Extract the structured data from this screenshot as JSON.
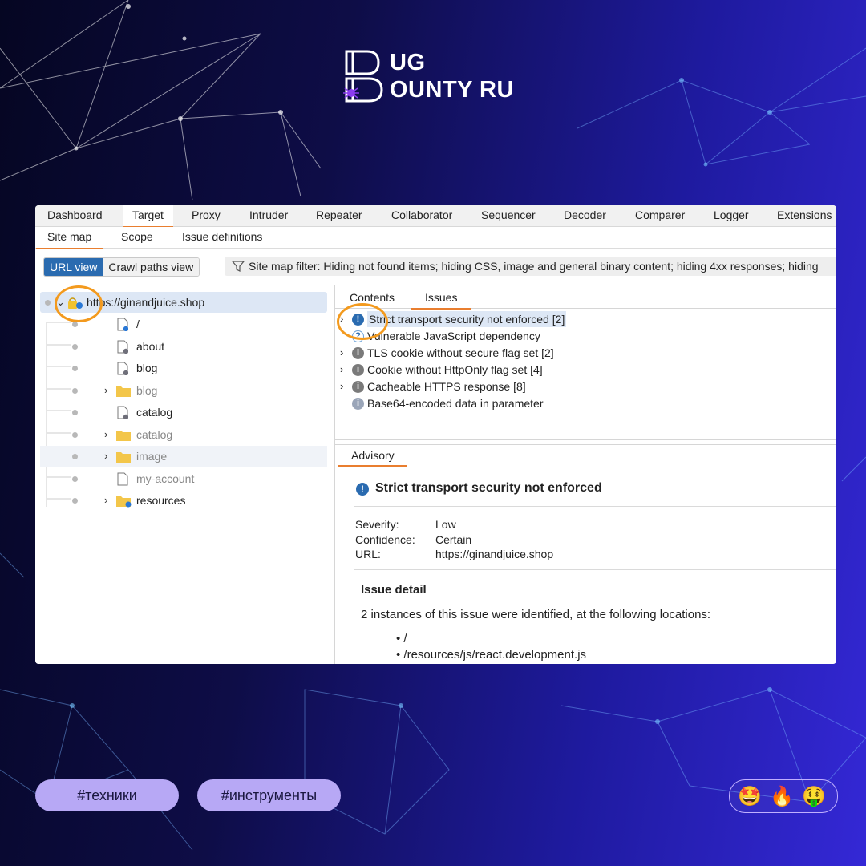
{
  "brand": {
    "line1": "UG",
    "line2": "OUNTY RU",
    "mark_letters": "BB"
  },
  "main_tabs": [
    "Dashboard",
    "Target",
    "Proxy",
    "Intruder",
    "Repeater",
    "Collaborator",
    "Sequencer",
    "Decoder",
    "Comparer",
    "Logger",
    "Extensions"
  ],
  "active_main_tab": "Target",
  "sub_tabs": [
    "Site map",
    "Scope",
    "Issue definitions"
  ],
  "view_toggle": {
    "url_view": "URL view",
    "crawl_view": "Crawl paths view"
  },
  "filter_text": "Site map filter: Hiding not found items; hiding CSS, image and general binary content; hiding 4xx responses; hiding",
  "tree": {
    "root": "https://ginandjuice.shop",
    "items": [
      {
        "label": "/",
        "type": "doc",
        "grey": false,
        "expandable": false
      },
      {
        "label": "about",
        "type": "doc",
        "grey": false,
        "expandable": false
      },
      {
        "label": "blog",
        "type": "doc",
        "grey": false,
        "expandable": false
      },
      {
        "label": "blog",
        "type": "folder",
        "grey": true,
        "expandable": true
      },
      {
        "label": "catalog",
        "type": "doc",
        "grey": false,
        "expandable": false
      },
      {
        "label": "catalog",
        "type": "folder",
        "grey": true,
        "expandable": true
      },
      {
        "label": "image",
        "type": "folder",
        "grey": true,
        "expandable": true
      },
      {
        "label": "my-account",
        "type": "doc",
        "grey": true,
        "expandable": false
      },
      {
        "label": "resources",
        "type": "folder",
        "grey": false,
        "expandable": true
      }
    ]
  },
  "content_tabs": [
    "Contents",
    "Issues"
  ],
  "issues": [
    {
      "label": "Strict transport security not enforced [2]",
      "icon": "exclamation-icon",
      "expandable": true
    },
    {
      "label": "Vulnerable JavaScript dependency",
      "icon": "question-icon",
      "expandable": false
    },
    {
      "label": "TLS cookie without secure flag set [2]",
      "icon": "info-icon",
      "expandable": true
    },
    {
      "label": "Cookie without HttpOnly flag set [4]",
      "icon": "info-icon",
      "expandable": true
    },
    {
      "label": "Cacheable HTTPS response [8]",
      "icon": "info-icon",
      "expandable": true
    },
    {
      "label": "Base64-encoded data in parameter",
      "icon": "info-icon-light",
      "expandable": false
    }
  ],
  "advisory": {
    "tab": "Advisory",
    "title": "Strict transport security not enforced",
    "severity_label": "Severity:",
    "severity": "Low",
    "confidence_label": "Confidence:",
    "confidence": "Certain",
    "url_label": "URL:",
    "url": "https://ginandjuice.shop",
    "detail_heading": "Issue detail",
    "detail_text": "2 instances of this issue were identified, at the following locations:",
    "locations": [
      "/",
      "/resources/js/react.development.js"
    ]
  },
  "tags": [
    "#техники",
    "#инструменты"
  ],
  "emojis": [
    "🤩",
    "🔥",
    "🤑"
  ],
  "colors": {
    "accent_orange": "#e97e2f",
    "selected_blue": "#2a6bb0",
    "tag_bg": "#b7a8f5"
  }
}
